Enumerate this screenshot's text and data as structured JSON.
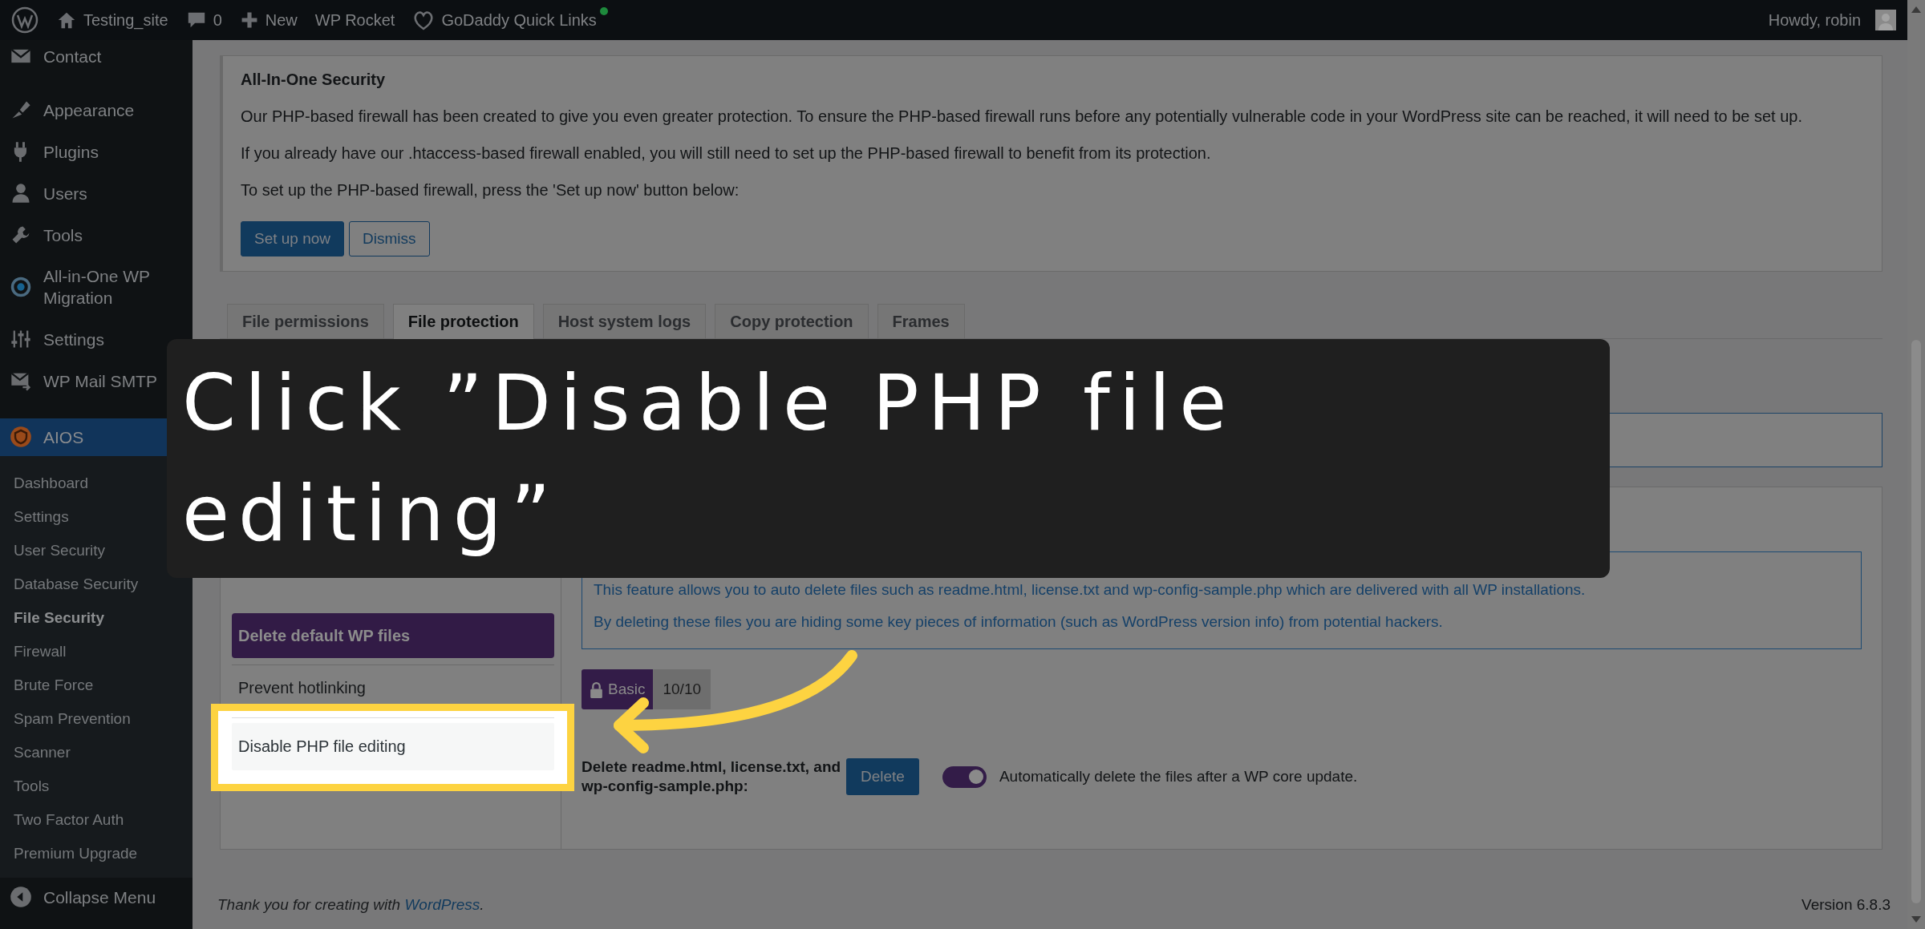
{
  "admin_bar": {
    "site": "Testing_site",
    "comments": "0",
    "new": "New",
    "links": [
      "WP Rocket"
    ],
    "quick_links": "GoDaddy Quick Links",
    "greeting": "Howdy, robin"
  },
  "sidebar": {
    "menu": [
      {
        "label": "Contact"
      },
      {
        "label": "Appearance"
      },
      {
        "label": "Plugins"
      },
      {
        "label": "Users"
      },
      {
        "label": "Tools"
      },
      {
        "label": "All-in-One WP Migration"
      },
      {
        "label": "Settings"
      },
      {
        "label": "WP Mail SMTP"
      }
    ],
    "current": {
      "label": "AIOS",
      "selected": true
    },
    "submenu": [
      {
        "label": "Dashboard",
        "selected": false
      },
      {
        "label": "Settings",
        "selected": false
      },
      {
        "label": "User Security",
        "selected": false
      },
      {
        "label": "Database Security",
        "selected": false
      },
      {
        "label": "File Security",
        "selected": true
      },
      {
        "label": "Firewall",
        "selected": false
      },
      {
        "label": "Brute Force",
        "selected": false
      },
      {
        "label": "Spam Prevention",
        "selected": false
      },
      {
        "label": "Scanner",
        "selected": false
      },
      {
        "label": "Tools",
        "selected": false
      },
      {
        "label": "Two Factor Auth",
        "selected": false
      },
      {
        "label": "Premium Upgrade",
        "selected": false
      }
    ],
    "collapse": "Collapse Menu"
  },
  "notice": {
    "title": "All-In-One Security",
    "paragraphs": [
      "Our PHP-based firewall has been created to give you even greater protection. To ensure the PHP-based firewall runs before any potentially vulnerable code in your WordPress site can be reached, it will need to be set up.",
      "If you already have our .htaccess-based firewall enabled, you will still need to set up the PHP-based firewall to benefit from its protection.",
      "To set up the PHP-based firewall, press the 'Set up now' button below:"
    ],
    "buttons": [
      {
        "label": "Set up now",
        "kind": "primary"
      },
      {
        "label": "Dismiss",
        "kind": "secondary"
      }
    ]
  },
  "tabs": [
    {
      "label": "File permissions",
      "selected": false
    },
    {
      "label": "File protection",
      "selected": true
    },
    {
      "label": "Host system logs",
      "selected": false
    },
    {
      "label": "Copy protection",
      "selected": false
    },
    {
      "label": "Frames",
      "selected": false
    }
  ],
  "settings_nav": [
    {
      "label": "Delete default WP files",
      "selected": true,
      "highlighted": false
    },
    {
      "label": "Prevent hotlinking",
      "selected": false,
      "highlighted": false
    },
    {
      "label": "Disable PHP file editing",
      "selected": false,
      "highlighted": true
    }
  ],
  "feature": {
    "info": [
      "This feature allows you to auto delete files such as readme.html, license.txt and wp-config-sample.php which are delivered with all WP installations.",
      "By deleting these files you are hiding some key pieces of information (such as WordPress version info) from potential hackers."
    ],
    "badge": {
      "label": "Basic",
      "score": "10/10"
    },
    "setting": {
      "label": "Delete readme.html, license.txt, and wp-config-sample.php:",
      "button": "Delete",
      "toggle": {
        "on": true,
        "label": "Automatically delete the files after a WP core update."
      }
    }
  },
  "footer": {
    "before": "Thank you for creating with ",
    "link": "WordPress",
    "after": ".",
    "version": "Version 6.8.3"
  },
  "callout": {
    "text": "Click ”Disable PHP file editing”"
  }
}
